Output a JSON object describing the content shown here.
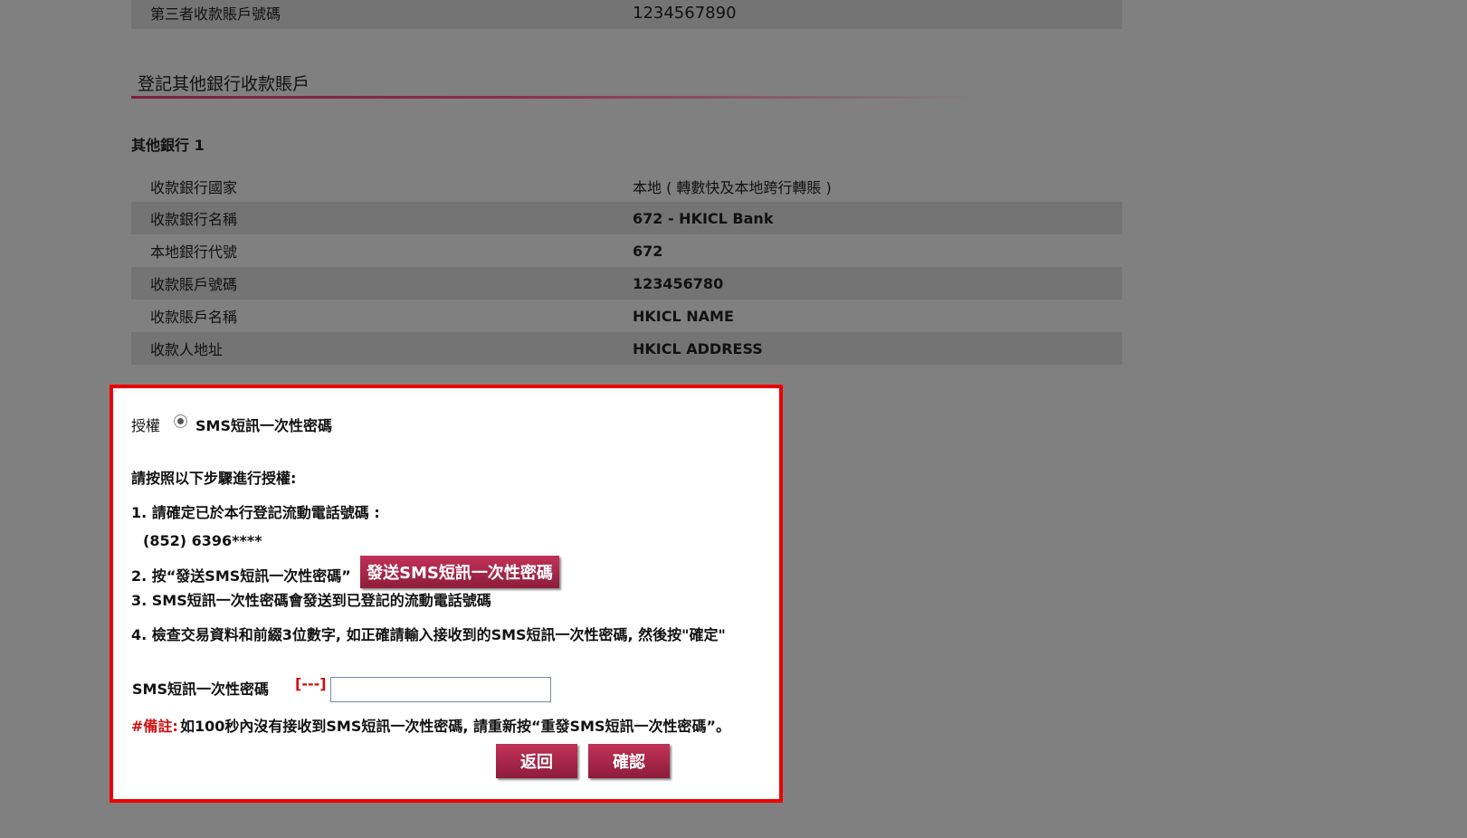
{
  "top_row": {
    "label": "第三者收款賬戶號碼",
    "value": "1234567890"
  },
  "section": {
    "title": "登記其他銀行收款賬戶",
    "subtitle": "其他銀行 1"
  },
  "details": [
    {
      "label": "收款銀行國家",
      "value": "本地 ( 轉數快及本地跨行轉賬 )"
    },
    {
      "label": "收款銀行名稱",
      "value": "672 - HKICL Bank"
    },
    {
      "label": "本地銀行代號",
      "value": "672"
    },
    {
      "label": "收款賬戶號碼",
      "value": "123456780"
    },
    {
      "label": "收款賬戶名稱",
      "value": "HKICL NAME"
    },
    {
      "label": "收款人地址",
      "value": "HKICL ADDRESS"
    }
  ],
  "auth": {
    "label": "授權",
    "method": "SMS短訊一次性密碼",
    "instructions_title": "請按照以下步驟進行授權:",
    "step1": "1. 請確定已於本行登記流動電話號碼 :",
    "phone": "(852) 6396****",
    "step2": "2. 按“發送SMS短訊一次性密碼”",
    "send_button": "發送SMS短訊一次性密碼",
    "step3": "3. SMS短訊一次性密碼會發送到已登記的流動電話號碼",
    "step4": "4. 檢查交易資料和前綴3位數字, 如正確請輸入接收到的SMS短訊一次性密碼, 然後按\"確定\"",
    "otp_label": "SMS短訊一次性密碼",
    "otp_prefix": "[---]",
    "otp_value": "",
    "note_prefix": "#備註:",
    "note": "如100秒內沒有接收到SMS短訊一次性密碼, 請重新按“重發SMS短訊一次性密碼”。",
    "back_button": "返回",
    "confirm_button": "確認"
  },
  "colors": {
    "overlay": "#808080",
    "brand": "#a8274a",
    "alert_border": "#ee0000",
    "note_red": "#d01010"
  }
}
